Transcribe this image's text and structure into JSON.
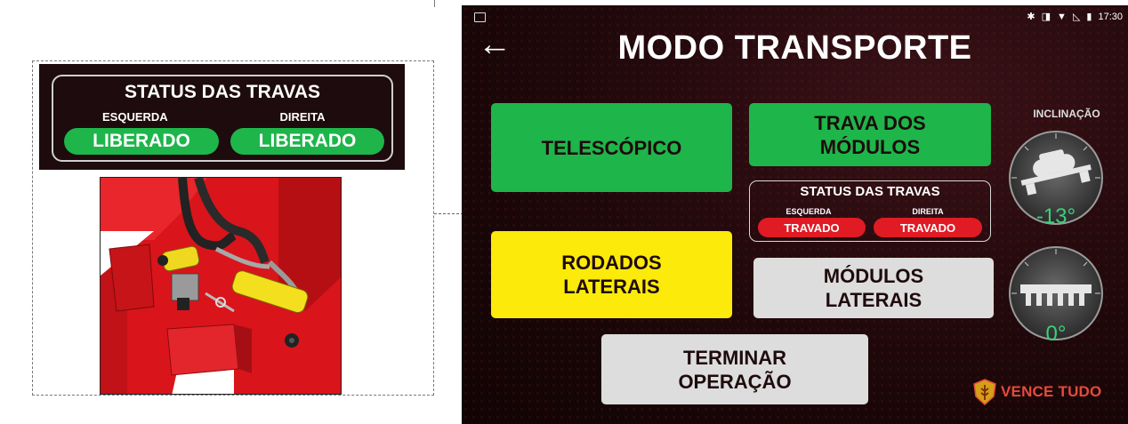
{
  "callout": {
    "status_title": "STATUS DAS TRAVAS",
    "left_label": "ESQUERDA",
    "right_label": "DIREITA",
    "left_value": "LIBERADO",
    "right_value": "LIBERADO",
    "value_color": "#1eb54a"
  },
  "screen": {
    "time": "17:30",
    "title": "MODO TRANSPORTE",
    "buttons": {
      "telescopico": "TELESCÓPICO",
      "trava_line1": "TRAVA DOS",
      "trava_line2": "MÓDULOS",
      "rodados_line1": "RODADOS",
      "rodados_line2": "LATERAIS",
      "modulos_line1": "MÓDULOS",
      "modulos_line2": "LATERAIS",
      "terminar_line1": "TERMINAR",
      "terminar_line2": "OPERAÇÃO"
    },
    "status": {
      "title": "STATUS DAS TRAVAS",
      "left_label": "ESQUERDA",
      "right_label": "DIREITA",
      "left_value": "TRAVADO",
      "right_value": "TRAVADO",
      "value_color": "#e01b24"
    },
    "inclinacao_label": "INCLINAÇÃO",
    "gauge_top_value": "-13°",
    "gauge_bottom_value": "0°",
    "brand": "VENCE TUDO",
    "colors": {
      "green": "#1eb54a",
      "yellow": "#fbea0a",
      "gray": "#dddddd",
      "red": "#e01b24",
      "brand": "#e54b3a"
    }
  }
}
